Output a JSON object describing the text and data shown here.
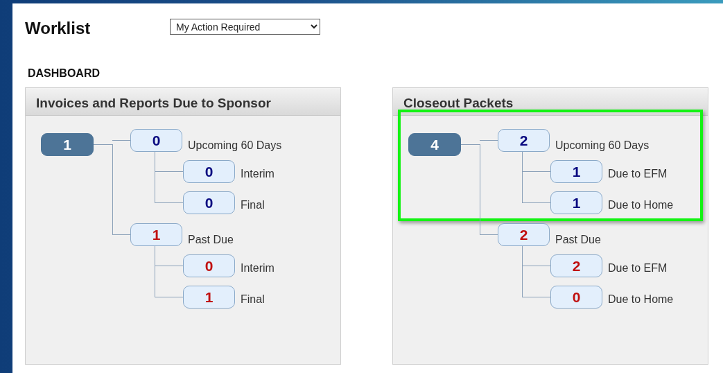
{
  "title": "Worklist",
  "filter": {
    "value": "My Action Required"
  },
  "section_heading": "DASHBOARD",
  "panels": [
    {
      "title": "Invoices and Reports Due to Sponsor",
      "total": "1",
      "groups": [
        {
          "count": "0",
          "label": "Upcoming 60 Days",
          "color": "#0a0a80",
          "highlighted": false,
          "children": [
            {
              "count": "0",
              "label": "Interim"
            },
            {
              "count": "0",
              "label": "Final"
            }
          ]
        },
        {
          "count": "1",
          "label": "Past Due",
          "color": "#c01010",
          "highlighted": false,
          "children": [
            {
              "count": "0",
              "label": "Interim"
            },
            {
              "count": "1",
              "label": "Final"
            }
          ]
        }
      ]
    },
    {
      "title": "Closeout Packets",
      "total": "4",
      "groups": [
        {
          "count": "2",
          "label": "Upcoming 60 Days",
          "color": "#0a0a80",
          "highlighted": true,
          "children": [
            {
              "count": "1",
              "label": "Due to EFM"
            },
            {
              "count": "1",
              "label": "Due to Home"
            }
          ]
        },
        {
          "count": "2",
          "label": "Past Due",
          "color": "#c01010",
          "highlighted": false,
          "children": [
            {
              "count": "2",
              "label": "Due to EFM"
            },
            {
              "count": "0",
              "label": "Due to Home"
            }
          ]
        }
      ]
    }
  ]
}
